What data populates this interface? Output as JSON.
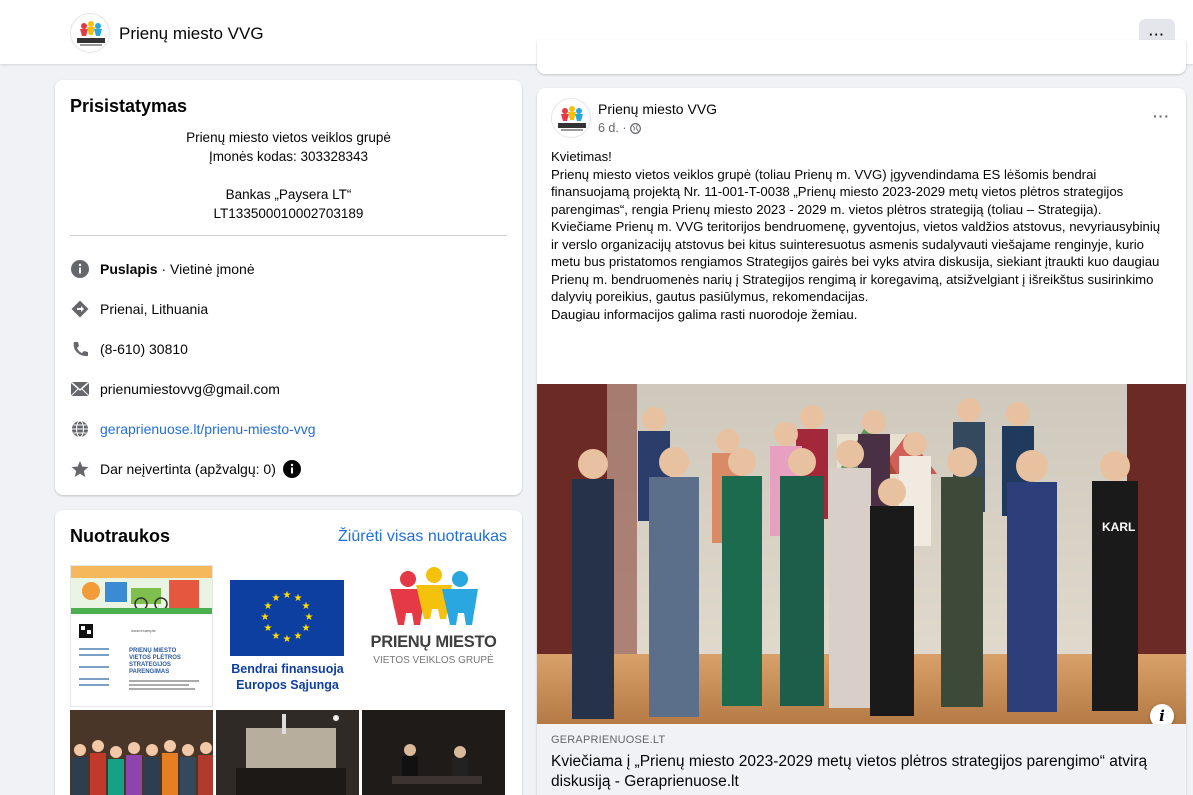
{
  "header": {
    "page_name": "Prienų miesto VVG",
    "more_label": "···"
  },
  "intro": {
    "title": "Prisistatymas",
    "lines": [
      "Prienų miesto vietos veiklos grupė",
      "Įmonės kodas: 303328343",
      "",
      "Bankas „Paysera LT“",
      "LT133500010002703189"
    ],
    "category_bold": "Puslapis",
    "category_rest": " · Vietinė įmonė",
    "location": "Prienai, Lithuania",
    "phone": "(8-610) 30810",
    "email": "prienumiestovvg@gmail.com",
    "website": "geraprienuose.lt/prienu-miesto-vvg",
    "rating": "Dar neįvertinta (apžvalgų: 0)"
  },
  "photos": {
    "title": "Nuotraukos",
    "see_all": "Žiūrėti visas nuotraukas",
    "eu_caption_1": "Bendrai finansuoja",
    "eu_caption_2": "Europos Sąjunga",
    "logo_text_1": "PRIENŲ MIESTO",
    "logo_text_2": "VIETOS VEIKLOS GRUPĖ",
    "poster_lines": [
      "PRIENŲ MIESTO",
      "VIETOS PLĖTROS",
      "STRATEGIJOS",
      "PARENGIMAS"
    ]
  },
  "post": {
    "author": "Prienų miesto VVG",
    "time": "6 d. · ",
    "dots": "···",
    "paragraphs": [
      "Kvietimas!",
      "Prienų miesto vietos veiklos grupė (toliau Prienų m. VVG) įgyvendindama ES lėšomis bendrai finansuojamą projektą Nr. 11-001-T-0038 „Prienų miesto 2023-2029 metų vietos plėtros strategijos parengimas“, rengia Prienų miesto 2023 - 2029 m. vietos plėtros strategiją (toliau – Strategija).",
      "Kviečiame Prienų m. VVG teritorijos bendruomenę, gyventojus, vietos valdžios atstovus, nevyriausybinių ir verslo organizacijų atstovus bei kitus suinteresuotus asmenis sudalyvauti viešajame renginyje, kurio metu bus pristatomos rengiamos Strategijos gairės bei vyks atvira diskusija, siekiant įtraukti kuo daugiau Prienų m. bendruomenės narių į Strategijos rengimą ir koregavimą, atsižvelgiant į išreikštus susirinkimo dalyvių poreikius, gautus pasiūlymus, rekomendacijas.",
      "Daugiau informacijos galima rasti nuorodoje žemiau."
    ],
    "link_domain": "GERAPRIENUOSE.LT",
    "link_title": "Kviečiama į „Prienų miesto 2023-2029 metų vietos plėtros strategijos parengimo“ atvirą diskusiją - Geraprienuose.lt",
    "info_label": "i"
  },
  "colors": {
    "link": "#216fdb",
    "background": "#f0f2f5",
    "eu_blue": "#0d3fa1",
    "eu_gold": "#ffdd00",
    "logo_blue": "#1a82c4"
  }
}
